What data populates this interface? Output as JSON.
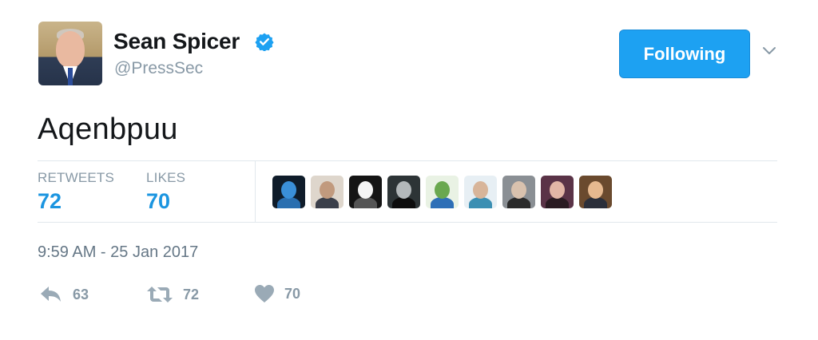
{
  "header": {
    "display_name": "Sean Spicer",
    "handle": "@PressSec",
    "follow_label": "Following",
    "verified": true
  },
  "tweet": {
    "text": "Aqenbpuu",
    "timestamp": "9:59 AM - 25 Jan 2017"
  },
  "stats": {
    "retweets_label": "RETWEETS",
    "retweets_value": "72",
    "likes_label": "LIKES",
    "likes_value": "70"
  },
  "likers": [
    {
      "bg": "#0f1c2a",
      "head": "#3a8fd8",
      "body": "#2a6fb0"
    },
    {
      "bg": "#ded6cc",
      "head": "#c19a7e",
      "body": "#3b3f4a"
    },
    {
      "bg": "#141414",
      "head": "#f4f4f4",
      "body": "#555555"
    },
    {
      "bg": "#2d3436",
      "head": "#b3b8ba",
      "body": "#0d0d0d"
    },
    {
      "bg": "#e9f2e4",
      "head": "#6aa84f",
      "body": "#2e6fb7"
    },
    {
      "bg": "#e7eff4",
      "head": "#d8b59a",
      "body": "#3b8fb3"
    },
    {
      "bg": "#8a8f94",
      "head": "#d9c2ae",
      "body": "#2b2b2b"
    },
    {
      "bg": "#5a3347",
      "head": "#e2b6a6",
      "body": "#2a1b22"
    },
    {
      "bg": "#6a4a2e",
      "head": "#e6b98f",
      "body": "#2b2f3a"
    }
  ],
  "actions": {
    "reply_count": "63",
    "retweet_count": "72",
    "like_count": "70"
  },
  "colors": {
    "accent": "#1da1f2",
    "stat_value": "#1b95e0",
    "muted": "#8899a6"
  }
}
